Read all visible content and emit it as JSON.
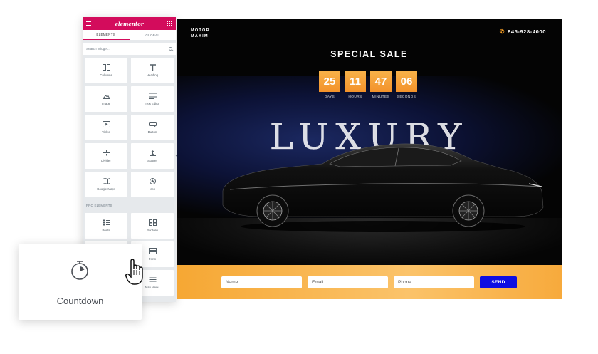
{
  "editor": {
    "logo": "elementor",
    "tabs": [
      "ELEMENTS",
      "GLOBAL"
    ],
    "search_placeholder": "Search Widget...",
    "widgets": [
      {
        "label": "Columns",
        "icon": "columns-icon"
      },
      {
        "label": "Heading",
        "icon": "heading-icon"
      },
      {
        "label": "Image",
        "icon": "image-icon"
      },
      {
        "label": "Text Editor",
        "icon": "text-editor-icon"
      },
      {
        "label": "Video",
        "icon": "video-icon"
      },
      {
        "label": "Button",
        "icon": "button-icon"
      },
      {
        "label": "Divider",
        "icon": "divider-icon"
      },
      {
        "label": "Spacer",
        "icon": "spacer-icon"
      },
      {
        "label": "Google Maps",
        "icon": "map-icon"
      },
      {
        "label": "Icon",
        "icon": "star-icon"
      }
    ],
    "pro_section_label": "PRO ELEMENTS",
    "pro_widgets": [
      {
        "label": "Posts",
        "icon": "posts-icon"
      },
      {
        "label": "Portfolio",
        "icon": "portfolio-icon"
      },
      {
        "label": "",
        "icon": "slides-icon"
      },
      {
        "label": "Form",
        "icon": "form-icon"
      },
      {
        "label": "",
        "icon": "login-icon"
      },
      {
        "label": "Nav Menu",
        "icon": "nav-menu-icon"
      }
    ]
  },
  "page": {
    "brand_line1": "MOTOR",
    "brand_line2": "MAXIM",
    "phone": "845-928-4000",
    "sale_title": "SPECIAL SALE",
    "countdown": [
      {
        "value": "25",
        "label": "DAYS"
      },
      {
        "value": "11",
        "label": "HOURS"
      },
      {
        "value": "47",
        "label": "MINUTES"
      },
      {
        "value": "06",
        "label": "SECONDS"
      }
    ],
    "hero_word": "LUXURY",
    "form": {
      "name_placeholder": "Name",
      "email_placeholder": "Email",
      "phone_placeholder": "Phone",
      "submit_label": "SEND"
    }
  },
  "drag_card": {
    "label": "Countdown",
    "icon": "stopwatch-icon"
  },
  "colors": {
    "elementor_pink": "#d30c5c",
    "countdown_orange": "#f39c24",
    "send_blue": "#0e0ee3"
  }
}
